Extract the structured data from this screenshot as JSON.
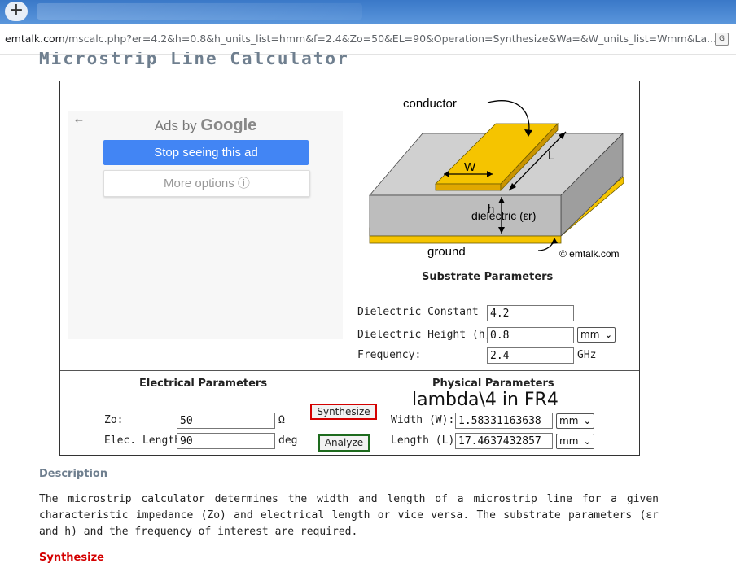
{
  "browser": {
    "new_tab_label": "+",
    "url_host": "emtalk.com",
    "url_path": "/mscalc.php?er=4.2&h=0.8&h_units_list=hmm&f=2.4&Zo=50&EL=90&Operation=Synthesize&Wa=&W_units_list=Wmm&La...",
    "translate_icon": "translate-icon"
  },
  "page": {
    "title": "Microstrip Line Calculator"
  },
  "ad": {
    "ads_by": "Ads by",
    "google": "Google",
    "stop_label": "Stop seeing this ad",
    "more_label": "More options ⓘ"
  },
  "diagram": {
    "conductor": "conductor",
    "w": "W",
    "l": "L",
    "h": "h",
    "dielectric": "dielectric (εr)",
    "ground": "ground",
    "copyright": "© emtalk.com"
  },
  "substrate": {
    "title": "Substrate Parameters",
    "dielectric_constant_label": "Dielectric Constant (εr):",
    "dielectric_constant_value": "4.2",
    "height_label": "Dielectric Height (h):",
    "height_value": "0.8",
    "height_unit": "mm",
    "frequency_label": "Frequency:",
    "frequency_value": "2.4",
    "frequency_unit": "GHz"
  },
  "electrical": {
    "title": "Electrical Parameters",
    "zo_label": "Zo:",
    "zo_value": "50",
    "zo_unit": "Ω",
    "length_label": "Elec. Length:",
    "length_value": "90",
    "length_unit": "deg"
  },
  "buttons": {
    "synthesize": "Synthesize",
    "analyze": "Analyze"
  },
  "physical": {
    "title": "Physical Parameters",
    "annotation": "lambda\\4 in FR4",
    "width_label": "Width (W):",
    "width_value": "1.58331163638",
    "width_unit": "mm",
    "length_label": "Length (L):",
    "length_value": "17.4637432857",
    "length_unit": "mm"
  },
  "description": {
    "heading": "Description",
    "text": "The microstrip calculator determines the width and length of a microstrip line for a given characteristic impedance (Zo) and electrical length or vice versa. The substrate parameters (εr and h) and the frequency of interest are required.",
    "synthesize_heading": "Synthesize"
  },
  "colors": {
    "accent_red": "#d40000",
    "conductor_yellow": "#f5c400",
    "substrate_gray": "#bdbdbd",
    "ad_blue": "#4285f4"
  }
}
